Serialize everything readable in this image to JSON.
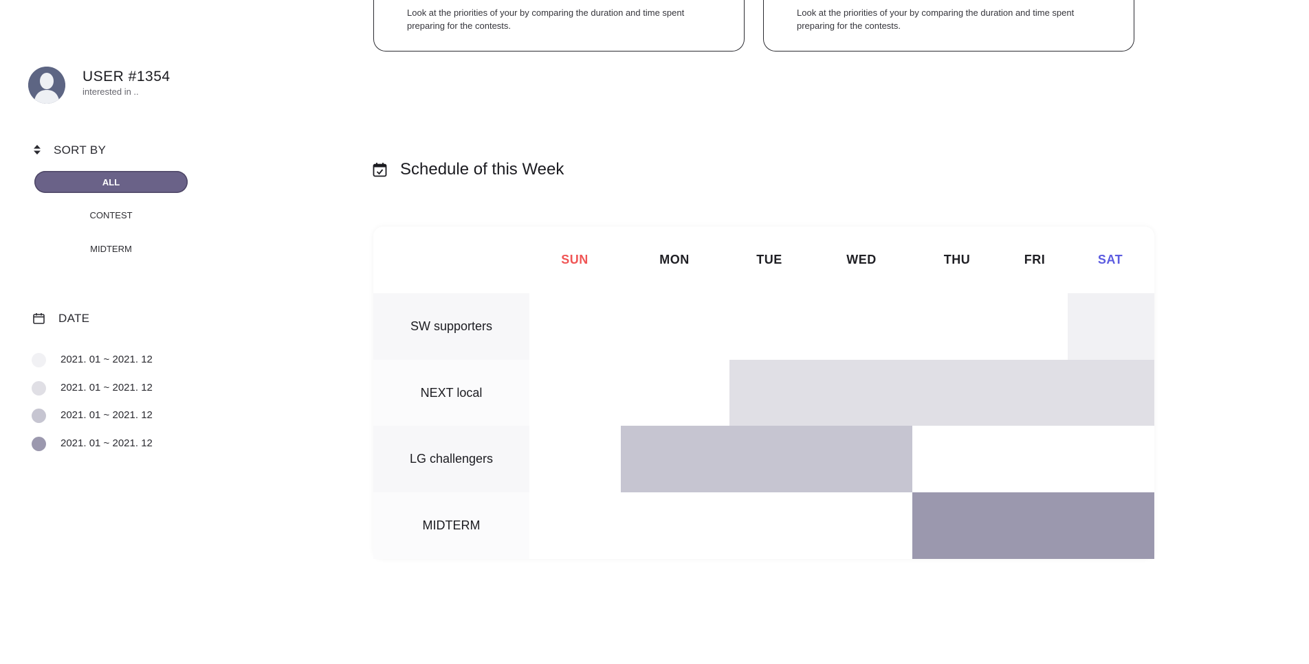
{
  "user": {
    "name": "USER #1354",
    "subtitle": "interested in .."
  },
  "sort": {
    "label": "SORT BY",
    "options": [
      "ALL",
      "CONTEST",
      "MIDTERM"
    ],
    "selected": "ALL"
  },
  "date": {
    "label": "DATE",
    "legend": [
      {
        "range": "2021. 01 ~ 2021. 12",
        "color": "#f1f1f4"
      },
      {
        "range": "2021. 01 ~ 2021. 12",
        "color": "#e0dfe5"
      },
      {
        "range": "2021. 01 ~ 2021. 12",
        "color": "#c6c5d1"
      },
      {
        "range": "2021. 01 ~ 2021. 12",
        "color": "#9b98ae"
      }
    ]
  },
  "cards": [
    {
      "text": "Look at the priorities of your by comparing the duration and time spent preparing for the contests."
    },
    {
      "text": "Look at the priorities of your by comparing the duration and time spent preparing for the contests."
    }
  ],
  "schedule": {
    "title": "Schedule of this Week",
    "days": [
      {
        "label": "SUN",
        "color": "#f05555"
      },
      {
        "label": "MON",
        "color": "#1f1f24"
      },
      {
        "label": "TUE",
        "color": "#1f1f24"
      },
      {
        "label": "WED",
        "color": "#1f1f24"
      },
      {
        "label": "THU",
        "color": "#1f1f24"
      },
      {
        "label": "FRI",
        "color": "#1f1f24"
      },
      {
        "label": "SAT",
        "color": "#5b5be0"
      }
    ],
    "rows": [
      {
        "label": "SW supporters",
        "span": [
          "SAT",
          "SAT"
        ],
        "color": "#f1f1f4"
      },
      {
        "label": "NEXT local",
        "span": [
          "TUE",
          "SAT"
        ],
        "color": "#e0dfe5"
      },
      {
        "label": "LG challengers",
        "span": [
          "MON",
          "WED"
        ],
        "color": "#c6c5d1"
      },
      {
        "label": "MIDTERM",
        "span": [
          "THU",
          "SAT"
        ],
        "color": "#9b98ae"
      }
    ]
  }
}
